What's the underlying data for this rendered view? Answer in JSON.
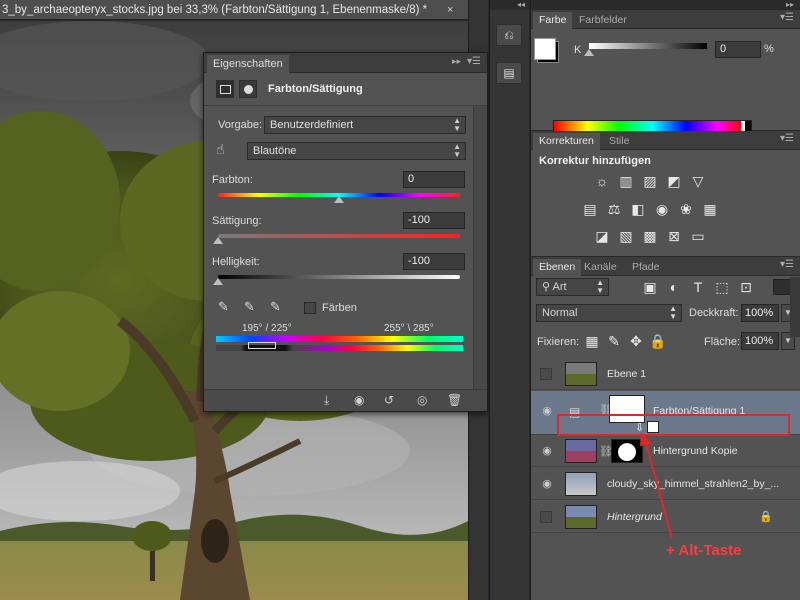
{
  "document": {
    "tab_title": "3_by_archaeopteryx_stocks.jpg bei 33,3% (Farbton/Sättigung 1, Ebenenmaske/8) *",
    "close": "×"
  },
  "properties": {
    "tab": "Eigenschaften",
    "header": "Farbton/Sättigung",
    "preset_label": "Vorgabe:",
    "preset_value": "Benutzerdefiniert",
    "range_value": "Blautöne",
    "hue_label": "Farbton:",
    "hue_value": "0",
    "hue_level": 0.5,
    "saturation_label": "Sättigung:",
    "saturation_value": "-100",
    "saturation_level": 0.0,
    "lightness_label": "Helligkeit:",
    "lightness_value": "-100",
    "lightness_level": 0.0,
    "colorize_label": "Färben",
    "range_left": "195° / 225°",
    "range_right": "255° \\ 285°"
  },
  "color_panel": {
    "tabs": [
      "Farbe",
      "Farbfelder"
    ],
    "channel_label": "K",
    "value": "0",
    "unit": "%",
    "level": 0.0
  },
  "adjustments_panel": {
    "tabs": [
      "Korrekturen",
      "Stile"
    ],
    "title": "Korrektur hinzufügen"
  },
  "layers_panel": {
    "tabs": [
      "Ebenen",
      "Kanäle",
      "Pfade"
    ],
    "filter_kind": "Art",
    "blend_mode": "Normal",
    "opacity_label": "Deckkraft:",
    "opacity_value": "100%",
    "lock_label": "Fixieren:",
    "fill_label": "Fläche:",
    "fill_value": "100%",
    "layers": [
      {
        "name": "Ebene 1",
        "visible": false
      },
      {
        "name": "Farbton/Sättigung 1",
        "visible": true,
        "selected": true
      },
      {
        "name": "Hintergrund Kopie",
        "visible": true
      },
      {
        "name": "cloudy_sky_himmel_strahlen2_by_...",
        "visible": true
      },
      {
        "name": "Hintergrund",
        "visible": false
      }
    ]
  },
  "annotation": {
    "text": "+ Alt-Taste",
    "color": "#e0262b"
  },
  "colors": {
    "selection": "#6b778a",
    "panel": "#535353"
  }
}
